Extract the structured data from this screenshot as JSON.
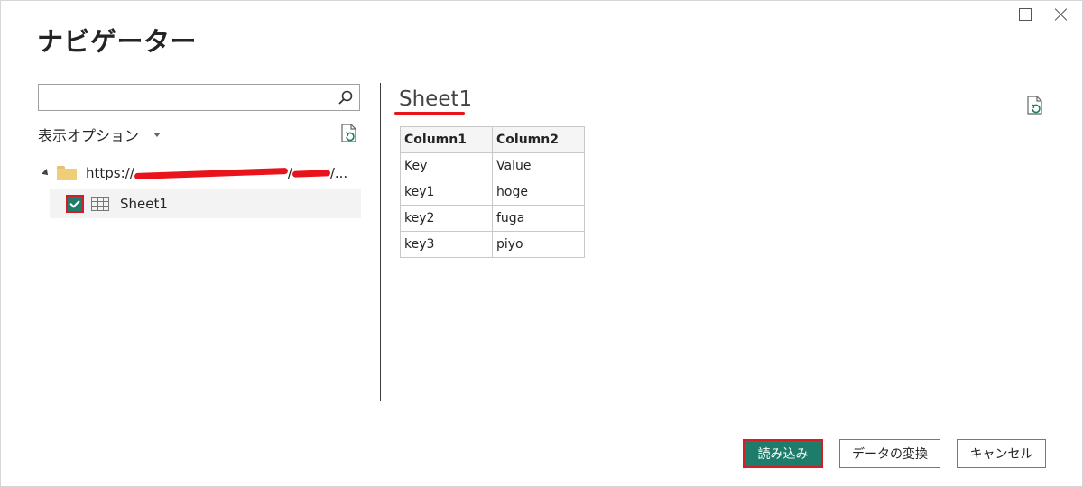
{
  "dialog": {
    "title": "ナビゲーター"
  },
  "left_pane": {
    "search": {
      "value": "",
      "placeholder": ""
    },
    "display_options_label": "表示オプション",
    "tree": {
      "folder": {
        "url_start": "https://",
        "url_sep1": "/",
        "url_sep2": "/..."
      },
      "items": [
        {
          "label": "Sheet1",
          "checked": true
        }
      ]
    }
  },
  "preview": {
    "title": "Sheet1",
    "columns": [
      "Column1",
      "Column2"
    ],
    "rows": [
      [
        "Key",
        "Value"
      ],
      [
        "key1",
        "hoge"
      ],
      [
        "key2",
        "fuga"
      ],
      [
        "key3",
        "piyo"
      ]
    ]
  },
  "buttons": {
    "load": "読み込み",
    "transform": "データの変換",
    "cancel": "キャンセル"
  },
  "colors": {
    "accent": "#1e7c6b",
    "highlight": "#d81c25"
  }
}
